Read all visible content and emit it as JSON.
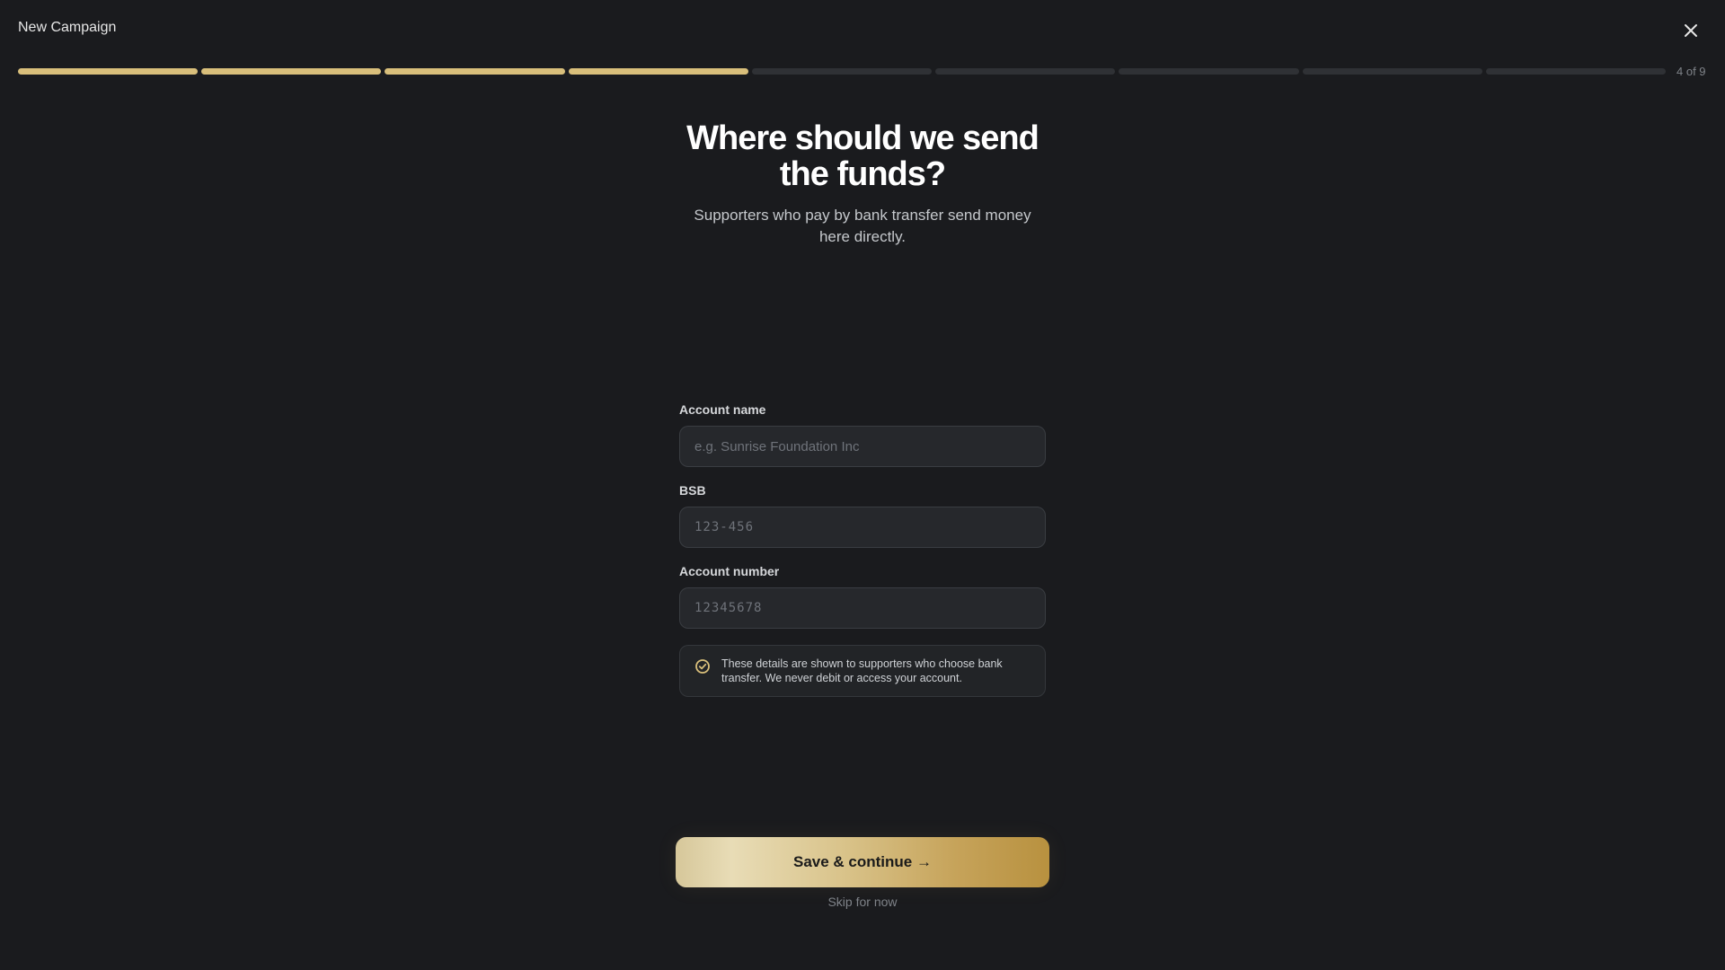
{
  "header": {
    "title": "New Campaign",
    "close_icon": "close-icon"
  },
  "progress": {
    "current_step": 4,
    "total_steps": 9,
    "label": "4 of 9",
    "complete_color": "#d9bf7b",
    "incomplete_color": "#2f3135"
  },
  "hero": {
    "title": "Where should we send the funds?",
    "subtitle": "Supporters who pay by bank transfer send money here directly."
  },
  "form": {
    "account_name": {
      "label": "Account name",
      "value": "",
      "placeholder": "e.g. Sunrise Foundation Inc"
    },
    "bsb": {
      "label": "BSB",
      "value": "",
      "placeholder": "123-456"
    },
    "account_number": {
      "label": "Account number",
      "value": "",
      "placeholder": "12345678"
    },
    "notice": {
      "icon": "check-circle-icon",
      "text": "These details are shown to supporters who choose bank transfer. We never debit or access your account."
    }
  },
  "actions": {
    "primary_label": "Save & continue →",
    "skip_label": "Skip for now"
  },
  "colors": {
    "background": "#1a1b1e",
    "accent": "#d9bf7b"
  }
}
